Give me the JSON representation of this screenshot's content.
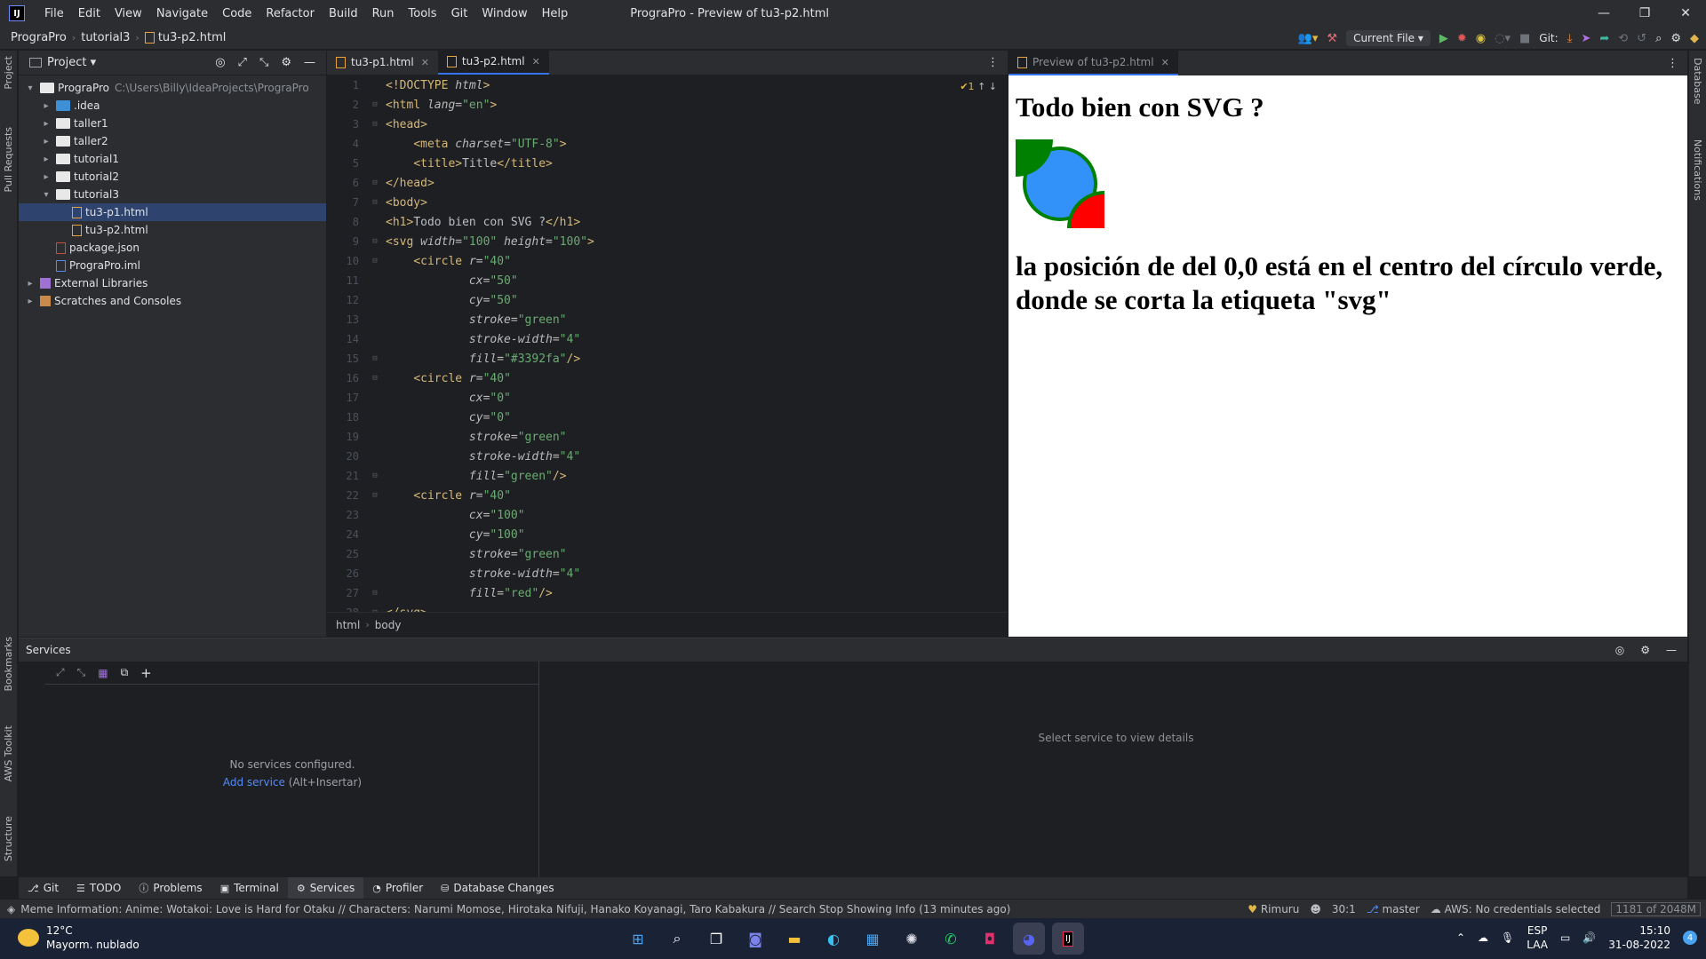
{
  "titlebar": {
    "menu": [
      "File",
      "Edit",
      "View",
      "Navigate",
      "Code",
      "Refactor",
      "Build",
      "Run",
      "Tools",
      "Git",
      "Window",
      "Help"
    ],
    "window_title": "PrograPro - Preview of tu3-p2.html",
    "logo_text": "IJ"
  },
  "navbar": {
    "crumbs": [
      "PrograPro",
      "tutorial3",
      "tu3-p2.html"
    ],
    "run_config": "Current File",
    "git_label": "Git:"
  },
  "left_strip": {
    "project": "Project",
    "pull_requests": "Pull Requests",
    "bookmarks": "Bookmarks",
    "aws_toolkit": "AWS Toolkit",
    "structure": "Structure"
  },
  "right_strip": {
    "database": "Database",
    "notifications": "Notifications"
  },
  "project": {
    "title": "Project",
    "tree": [
      {
        "label": "PrograPro",
        "hint": "C:\\Users\\Billy\\IdeaProjects\\PrograPro",
        "indent": 0,
        "arrow": "▾",
        "icon": "folder"
      },
      {
        "label": ".idea",
        "indent": 1,
        "arrow": "▸",
        "icon": "folder-blue"
      },
      {
        "label": "taller1",
        "indent": 1,
        "arrow": "▸",
        "icon": "folder"
      },
      {
        "label": "taller2",
        "indent": 1,
        "arrow": "▸",
        "icon": "folder"
      },
      {
        "label": "tutorial1",
        "indent": 1,
        "arrow": "▸",
        "icon": "folder"
      },
      {
        "label": "tutorial2",
        "indent": 1,
        "arrow": "▸",
        "icon": "folder"
      },
      {
        "label": "tutorial3",
        "indent": 1,
        "arrow": "▾",
        "icon": "folder"
      },
      {
        "label": "tu3-p1.html",
        "indent": 2,
        "arrow": "",
        "icon": "html",
        "selected": true
      },
      {
        "label": "tu3-p2.html",
        "indent": 2,
        "arrow": "",
        "icon": "html"
      },
      {
        "label": "package.json",
        "indent": 1,
        "arrow": "",
        "icon": "json"
      },
      {
        "label": "PrograPro.iml",
        "indent": 1,
        "arrow": "",
        "icon": "iml"
      },
      {
        "label": "External Libraries",
        "indent": 0,
        "arrow": "▸",
        "icon": "lib"
      },
      {
        "label": "Scratches and Consoles",
        "indent": 0,
        "arrow": "▸",
        "icon": "scr"
      }
    ]
  },
  "editor": {
    "tabs": [
      {
        "label": "tu3-p1.html",
        "active": false
      },
      {
        "label": "tu3-p2.html",
        "active": true
      }
    ],
    "inspection": "✔1",
    "lines": [
      [
        [
          "doct",
          "<!DOCTYPE "
        ],
        [
          "attr",
          "html"
        ],
        [
          "doct",
          ">"
        ]
      ],
      [
        [
          "tag",
          "<html "
        ],
        [
          "attr",
          "lang="
        ],
        [
          "str",
          "\"en\""
        ],
        [
          "tag",
          ">"
        ]
      ],
      [
        [
          "tag",
          "<head>"
        ]
      ],
      [
        [
          "txt",
          "    "
        ],
        [
          "tag",
          "<meta "
        ],
        [
          "attr",
          "charset="
        ],
        [
          "str",
          "\"UTF-8\""
        ],
        [
          "tag",
          ">"
        ]
      ],
      [
        [
          "txt",
          "    "
        ],
        [
          "tag",
          "<title>"
        ],
        [
          "txt",
          "Title"
        ],
        [
          "tag",
          "</title>"
        ]
      ],
      [
        [
          "tag",
          "</head>"
        ]
      ],
      [
        [
          "tag",
          "<body>"
        ]
      ],
      [
        [
          "tag",
          "<h1>"
        ],
        [
          "txt",
          "Todo bien con SVG ?"
        ],
        [
          "tag",
          "</h1>"
        ]
      ],
      [
        [
          "tag",
          "<svg "
        ],
        [
          "attr",
          "width="
        ],
        [
          "str",
          "\"100\" "
        ],
        [
          "attr",
          "height="
        ],
        [
          "str",
          "\"100\""
        ],
        [
          "tag",
          ">"
        ]
      ],
      [
        [
          "txt",
          "    "
        ],
        [
          "tag",
          "<circle "
        ],
        [
          "attr",
          "r="
        ],
        [
          "str",
          "\"40\""
        ]
      ],
      [
        [
          "txt",
          "            "
        ],
        [
          "attr",
          "cx="
        ],
        [
          "str",
          "\"50\""
        ]
      ],
      [
        [
          "txt",
          "            "
        ],
        [
          "attr",
          "cy="
        ],
        [
          "str",
          "\"50\""
        ]
      ],
      [
        [
          "txt",
          "            "
        ],
        [
          "attr",
          "stroke="
        ],
        [
          "str",
          "\"green\""
        ]
      ],
      [
        [
          "txt",
          "            "
        ],
        [
          "attr",
          "stroke-width="
        ],
        [
          "str",
          "\"4\""
        ]
      ],
      [
        [
          "txt",
          "            "
        ],
        [
          "attr",
          "fill="
        ],
        [
          "str",
          "\"#3392fa\""
        ],
        [
          "tag",
          "/>"
        ]
      ],
      [
        [
          "txt",
          "    "
        ],
        [
          "tag",
          "<circle "
        ],
        [
          "attr",
          "r="
        ],
        [
          "str",
          "\"40\""
        ]
      ],
      [
        [
          "txt",
          "            "
        ],
        [
          "attr",
          "cx="
        ],
        [
          "str",
          "\"0\""
        ]
      ],
      [
        [
          "txt",
          "            "
        ],
        [
          "attr",
          "cy="
        ],
        [
          "str",
          "\"0\""
        ]
      ],
      [
        [
          "txt",
          "            "
        ],
        [
          "attr",
          "stroke="
        ],
        [
          "str",
          "\"green\""
        ]
      ],
      [
        [
          "txt",
          "            "
        ],
        [
          "attr",
          "stroke-width="
        ],
        [
          "str",
          "\"4\""
        ]
      ],
      [
        [
          "txt",
          "            "
        ],
        [
          "attr",
          "fill="
        ],
        [
          "str",
          "\"green\""
        ],
        [
          "tag",
          "/>"
        ]
      ],
      [
        [
          "txt",
          "    "
        ],
        [
          "tag",
          "<circle "
        ],
        [
          "attr",
          "r="
        ],
        [
          "str",
          "\"40\""
        ]
      ],
      [
        [
          "txt",
          "            "
        ],
        [
          "attr",
          "cx="
        ],
        [
          "str",
          "\"100\""
        ]
      ],
      [
        [
          "txt",
          "            "
        ],
        [
          "attr",
          "cy="
        ],
        [
          "str",
          "\"100\""
        ]
      ],
      [
        [
          "txt",
          "            "
        ],
        [
          "attr",
          "stroke="
        ],
        [
          "str",
          "\"green\""
        ]
      ],
      [
        [
          "txt",
          "            "
        ],
        [
          "attr",
          "stroke-width="
        ],
        [
          "str",
          "\"4\""
        ]
      ],
      [
        [
          "txt",
          "            "
        ],
        [
          "attr",
          "fill="
        ],
        [
          "str",
          "\"red\""
        ],
        [
          "tag",
          "/>"
        ]
      ],
      [
        [
          "tag",
          "</svg>"
        ]
      ]
    ],
    "breadcrumb": [
      "html",
      "body"
    ]
  },
  "preview": {
    "tab_label": "Preview of tu3-p2.html",
    "heading": "Todo bien con SVG ?",
    "note": "la posición de del 0,0 está en el centro del círculo verde, donde se corta la etiqueta \"svg\"",
    "colors": {
      "blue": "#3392fa",
      "green": "green",
      "red": "red"
    }
  },
  "services": {
    "title": "Services",
    "empty_text": "No services configured.",
    "add_service": "Add service",
    "add_shortcut": "(Alt+Insertar)",
    "detail_text": "Select service to view details"
  },
  "tool_windows": [
    "Git",
    "TODO",
    "Problems",
    "Terminal",
    "Services",
    "Profiler",
    "Database Changes"
  ],
  "tool_icons": [
    "⎇",
    "☰",
    "ⓘ",
    "▣",
    "⚙",
    "◔",
    "⛁"
  ],
  "status": {
    "message": "Meme Information:  Anime: Wotakoi: Love is Hard for Otaku // Characters: Narumi Momose, Hirotaka Nifuji, Hanako Koyanagi, Taro Kabakura // Search   Stop Showing Info (13 minutes ago)",
    "user": "Rimuru",
    "position": "30:1",
    "branch": "master",
    "aws": "AWS: No credentials selected",
    "memory": "1181 of 2048M"
  },
  "taskbar": {
    "temp": "12°C",
    "weather": "Mayorm. nublado",
    "lang1": "ESP",
    "lang2": "LAA",
    "time": "15:10",
    "date": "31-08-2022",
    "badge": "4"
  }
}
